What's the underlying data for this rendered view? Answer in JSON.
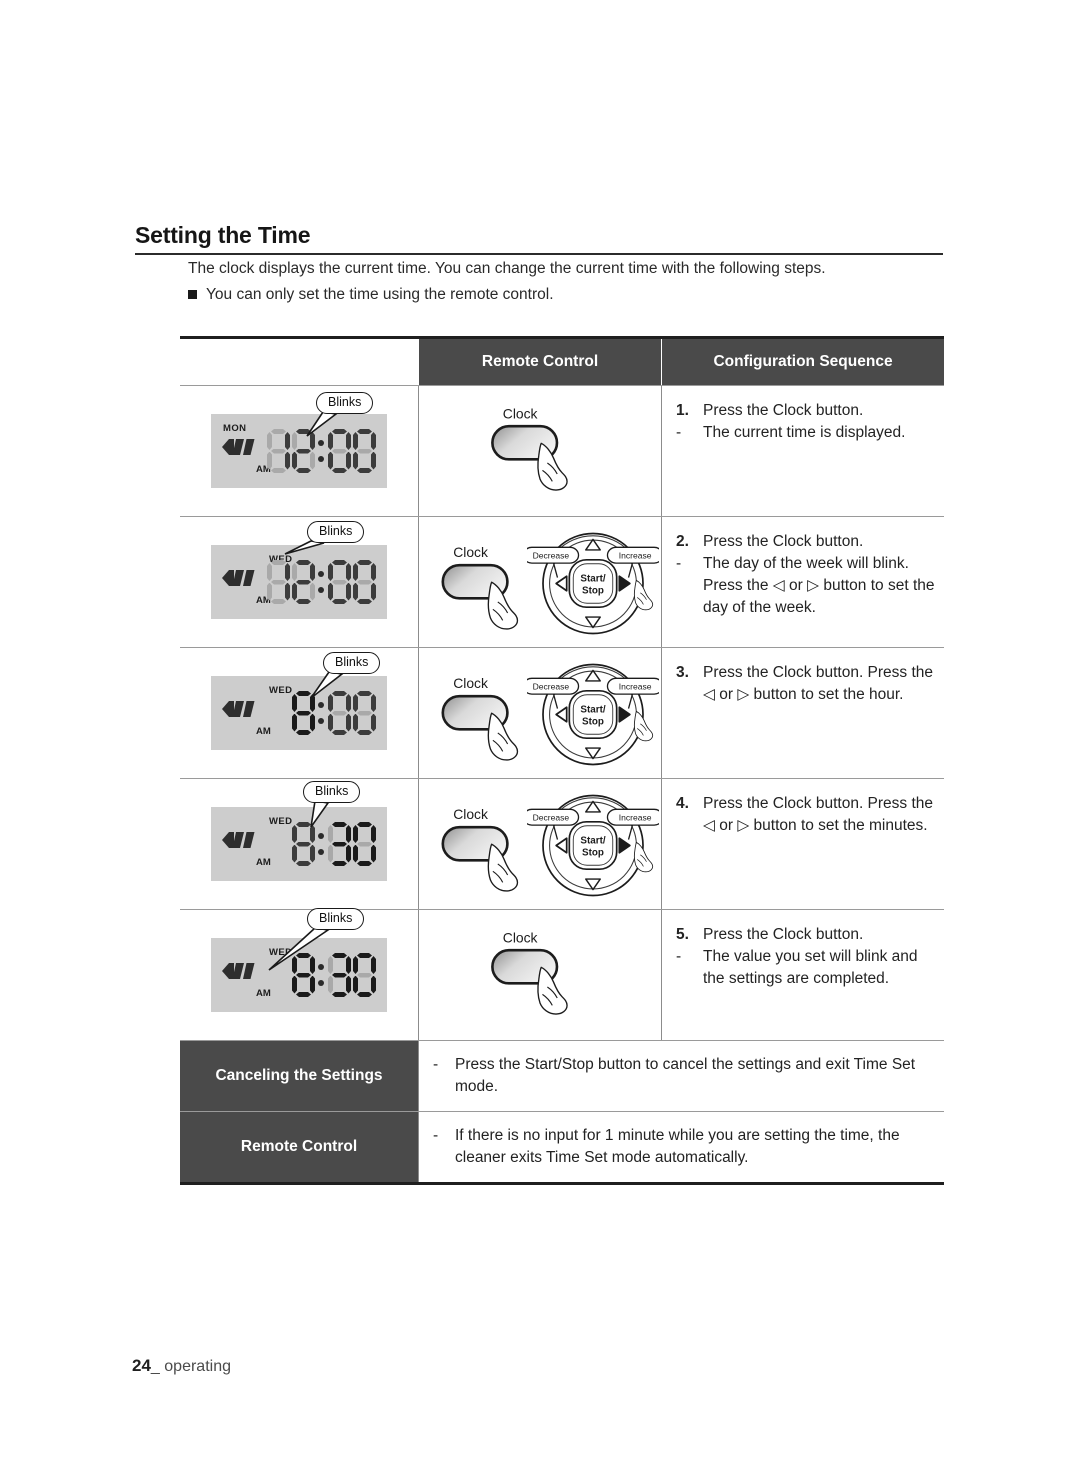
{
  "document": {
    "heading": "Setting the Time",
    "intro_paragraph": "The clock displays the current time. You can change the current time with the following steps.",
    "intro_bullet": "You can only set the time using the remote control.",
    "footer_page": "24",
    "footer_label": "operating"
  },
  "table": {
    "headers": {
      "col1": "",
      "col2": "Remote Control",
      "col3": "Configuration Sequence"
    },
    "rows": [
      {
        "lcd": {
          "day": "MON",
          "day_position": "left",
          "ampm": "AM",
          "time": "12:00",
          "digits": [
            "1",
            "2",
            "0",
            "0"
          ],
          "blink_digits": [],
          "blink_day": false,
          "callout": "Blinks",
          "callout_target": "time"
        },
        "remote": {
          "clock_label": "Clock",
          "has_dial": false,
          "dial": null
        },
        "sequence": [
          {
            "marker": "1.",
            "text": "Press the Clock button."
          },
          {
            "marker": "-",
            "text": "The current time is displayed."
          }
        ]
      },
      {
        "lcd": {
          "day": "WED",
          "day_position": "center",
          "ampm": "AM",
          "time": "12:00",
          "digits": [
            "1",
            "2",
            "0",
            "0"
          ],
          "blink_digits": [],
          "blink_day": true,
          "callout": "Blinks",
          "callout_target": "day"
        },
        "remote": {
          "clock_label": "Clock",
          "has_dial": true,
          "dial": {
            "center_line1": "Start/",
            "center_line2": "Stop",
            "decrease_label": "Decrease",
            "increase_label": "Increase"
          }
        },
        "sequence": [
          {
            "marker": "2.",
            "text": "Press the Clock button."
          },
          {
            "marker": "-",
            "text": "The day of the week will blink. Press the ◁ or ▷ button to set the day of the week."
          }
        ]
      },
      {
        "lcd": {
          "day": "WED",
          "day_position": "center",
          "ampm": "AM",
          "time": "8:00",
          "digits": [
            "",
            "8",
            "0",
            "0"
          ],
          "blink_digits": [
            1
          ],
          "blink_day": false,
          "callout": "Blinks",
          "callout_target": "hour"
        },
        "remote": {
          "clock_label": "Clock",
          "has_dial": true,
          "dial": {
            "center_line1": "Start/",
            "center_line2": "Stop",
            "decrease_label": "Decrease",
            "increase_label": "Increase"
          }
        },
        "sequence": [
          {
            "marker": "3.",
            "text": "Press the Clock button. Press the ◁ or ▷ button to set the hour."
          }
        ]
      },
      {
        "lcd": {
          "day": "WED",
          "day_position": "center",
          "ampm": "AM",
          "time": "8:30",
          "digits": [
            "",
            "8",
            "3",
            "0"
          ],
          "blink_digits": [
            2,
            3
          ],
          "blink_day": false,
          "callout": "Blinks",
          "callout_target": "minutes"
        },
        "remote": {
          "clock_label": "Clock",
          "has_dial": true,
          "dial": {
            "center_line1": "Start/",
            "center_line2": "Stop",
            "decrease_label": "Decrease",
            "increase_label": "Increase"
          }
        },
        "sequence": [
          {
            "marker": "4.",
            "text": "Press the Clock button. Press the ◁ or ▷ button to set the minutes."
          }
        ]
      },
      {
        "lcd": {
          "day": "WED",
          "day_position": "center",
          "ampm": "AM",
          "time": "8:30",
          "digits": [
            "",
            "8",
            "3",
            "0"
          ],
          "blink_digits": [
            1,
            2,
            3
          ],
          "blink_day": true,
          "callout": "Blinks",
          "callout_target": "all"
        },
        "remote": {
          "clock_label": "Clock",
          "has_dial": false,
          "dial": null
        },
        "sequence": [
          {
            "marker": "5.",
            "text": "Press the Clock button."
          },
          {
            "marker": "-",
            "text": "The value you set will blink and the settings are completed."
          }
        ]
      }
    ],
    "bottom_rows": [
      {
        "label": "Canceling the Settings",
        "marker": "-",
        "text": "Press the Start/Stop button to cancel the settings and exit Time Set mode."
      },
      {
        "label": "Remote Control",
        "marker": "-",
        "text": "If there is no input for 1 minute while you are setting the time, the cleaner exits Time Set mode automatically."
      }
    ]
  },
  "colors": {
    "header_bg": "#4a4a4a",
    "lcd_bg": "#cdcdcd",
    "segment_on": "#3c3c3c",
    "segment_off": "#a9a9a9",
    "segment_blink": "#1a1a1a",
    "rule": "#1f1f1f"
  }
}
